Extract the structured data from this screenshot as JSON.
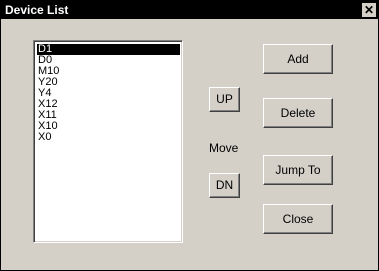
{
  "window": {
    "title": "Device List",
    "close_label": "✕"
  },
  "device_list": {
    "items": [
      "D1",
      "D0",
      "M10",
      "Y20",
      "Y4",
      "X12",
      "X11",
      "X10",
      "X0"
    ],
    "selected_index": 0
  },
  "move": {
    "up_label": "UP",
    "label": "Move",
    "down_label": "DN"
  },
  "actions": {
    "add_label": "Add",
    "delete_label": "Delete",
    "jump_to_label": "Jump To",
    "close_label": "Close"
  },
  "colors": {
    "title_bar": "#000000",
    "dialog_bg": "#d4d0c8",
    "selection_bg": "#000000"
  }
}
